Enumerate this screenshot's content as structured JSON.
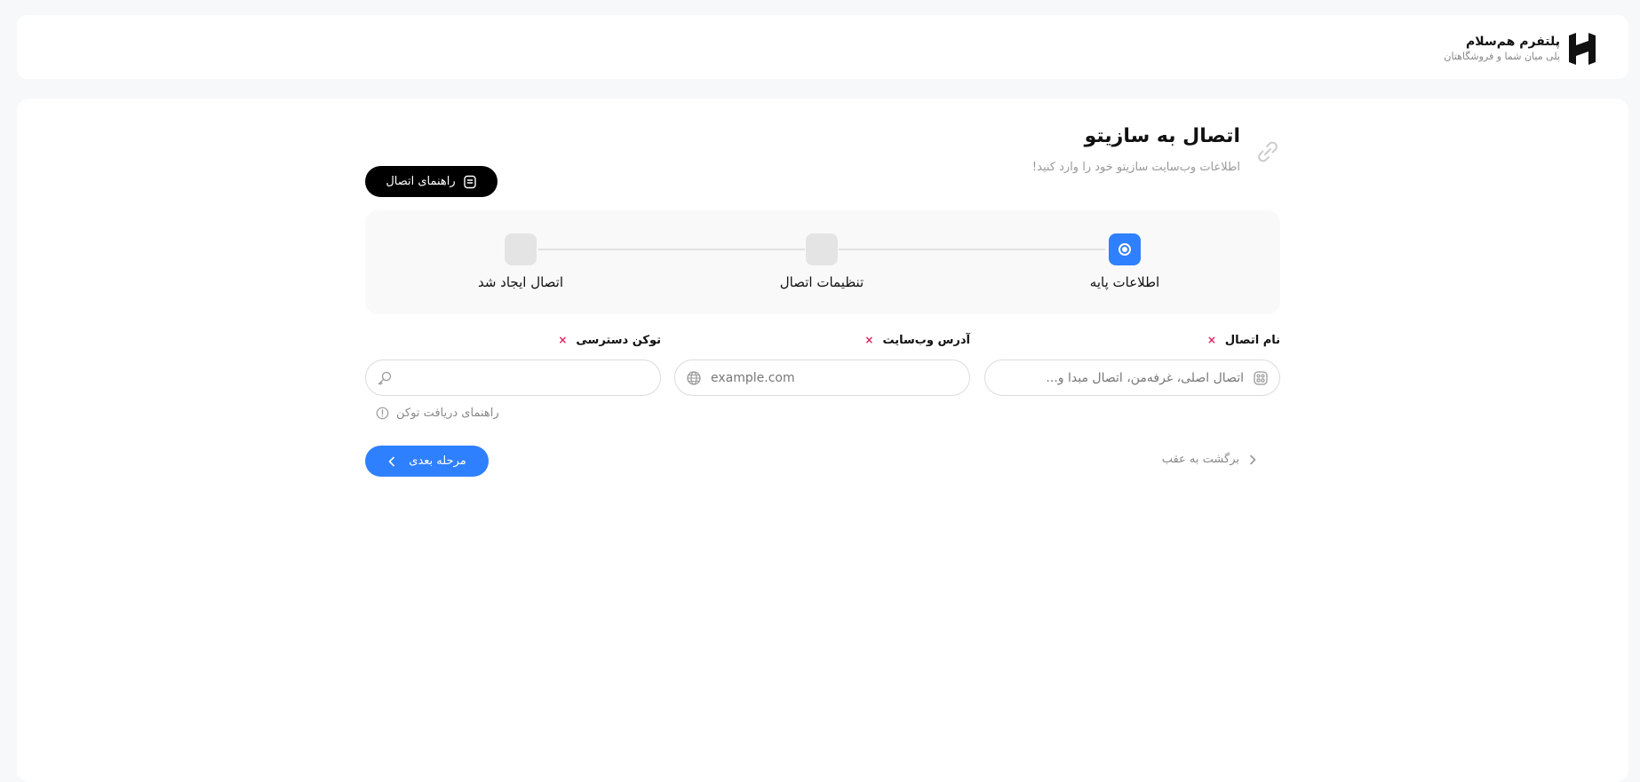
{
  "brand": {
    "title": "پلتفرم هم‌سلام",
    "subtitle": "پلی میان شما و فروشگاهتان"
  },
  "page": {
    "title": "اتصال به سازیتو",
    "subtitle": "اطلاعات وب‌سایت سازیتو خود را وارد کنید!",
    "guide_button": "راهنمای اتصال"
  },
  "steps": [
    {
      "label": "اطلاعات پایه",
      "state": "active"
    },
    {
      "label": "تنظیمات اتصال",
      "state": "inactive"
    },
    {
      "label": "اتصال ایجاد شد",
      "state": "inactive"
    }
  ],
  "fields": {
    "name": {
      "label": "نام اتصال",
      "placeholder": "اتصال اصلی، غرفه‌من، اتصال مبدا و..."
    },
    "website": {
      "label": "آدرس وب‌سایت",
      "placeholder": "example.com"
    },
    "token": {
      "label": "توکن دسترسی",
      "placeholder": ""
    },
    "required_mark": "×"
  },
  "token_help": "راهنمای دریافت توکن",
  "actions": {
    "next": "مرحله بعدی",
    "back": "برگشت به عقب"
  },
  "colors": {
    "accent": "#2f80ff",
    "required": "#e0245e"
  }
}
